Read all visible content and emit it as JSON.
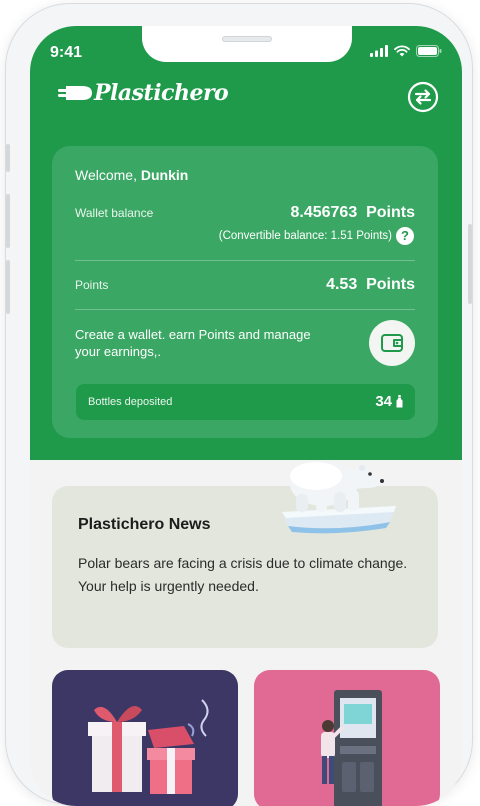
{
  "status_bar": {
    "time": "9:41"
  },
  "header": {
    "logo_text": "Plastichero",
    "swap_icon": "swap-arrows-icon"
  },
  "wallet_card": {
    "welcome_prefix": "Welcome,",
    "user_name": "Dunkin",
    "wallet_balance_label": "Wallet balance",
    "wallet_balance_value": "8.456763  Points",
    "convertible_text": "(Convertible balance: 1.51 Points)",
    "points_label": "Points",
    "points_value": "4.53  Points",
    "promo_text": "Create a wallet. earn Points and manage your earnings,.",
    "bottles_label": "Bottles deposited",
    "bottles_value": "34"
  },
  "news": {
    "title": "Plastichero News",
    "body_line1": "Polar bears are facing a crisis due to climate change.",
    "body_line2": "Your help is urgently needed."
  },
  "colors": {
    "brand_green": "#1f9a4b",
    "card_green": "#3aa864",
    "news_bg": "#e3e6dc",
    "gift_tile": "#3d3766",
    "machine_tile": "#e06a93"
  }
}
